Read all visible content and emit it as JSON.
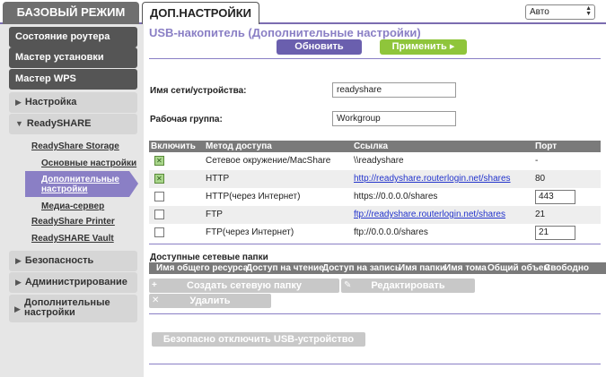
{
  "tabs": {
    "basic": "БАЗОВЫЙ РЕЖИМ",
    "advanced": "ДОП.НАСТРОЙКИ"
  },
  "language": {
    "selected": "Авто"
  },
  "sidebar": {
    "router_status": "Состояние роутера",
    "setup_wizard": "Мастер установки",
    "wps_wizard": "Мастер WPS",
    "setup": "Настройка",
    "readyshare": "ReadySHARE",
    "readyshare_storage": "ReadyShare Storage",
    "basic_settings": "Основные настройки",
    "advanced_settings_line1": "Дополнительные",
    "advanced_settings_line2": "настройки",
    "media_server": "Медиа-сервер",
    "readyshare_printer": "ReadyShare Printer",
    "readyshare_vault": "ReadySHARE Vault",
    "security": "Безопасность",
    "administration": "Администрирование",
    "advanced_setup_line1": "Дополнительные",
    "advanced_setup_line2": "настройки"
  },
  "main": {
    "title": "USB-накопитель (Дополнительные настройки)",
    "refresh": "Обновить",
    "apply": "Применить ▸",
    "device_name_label": "Имя сети/устройства:",
    "device_name_value": "readyshare",
    "workgroup_label": "Рабочая группа:",
    "workgroup_value": "Workgroup",
    "table_headers": {
      "enable": "Включить",
      "method": "Метод доступа",
      "link": "Ссылка",
      "port": "Порт"
    },
    "rows": [
      {
        "enabled": true,
        "method": "Сетевое окружение/MacShare",
        "link": "\\\\readyshare",
        "port": "-"
      },
      {
        "enabled": true,
        "method": "HTTP",
        "link": "http://readyshare.routerlogin.net/shares",
        "port": "80"
      },
      {
        "enabled": false,
        "method": "HTTP(через Интернет)",
        "link": "https://0.0.0.0/shares",
        "port": "443"
      },
      {
        "enabled": false,
        "method": "FTP",
        "link": "ftp://readyshare.routerlogin.net/shares",
        "port": "21"
      },
      {
        "enabled": false,
        "method": "FTP(через Интернет)",
        "link": "ftp://0.0.0.0/shares",
        "port": "21"
      }
    ],
    "folders_title": "Доступные сетевые папки",
    "folder_headers": [
      "Имя общего ресурса",
      "Доступ на чтение",
      "Доступ на запись",
      "Имя папки",
      "Имя тома",
      "Общий объем",
      "Свободно"
    ],
    "create_folder": "Создать сетевую папку",
    "edit": "Редактировать",
    "delete": "Удалить",
    "safe_remove": "Безопасно отключить USB-устройство"
  }
}
